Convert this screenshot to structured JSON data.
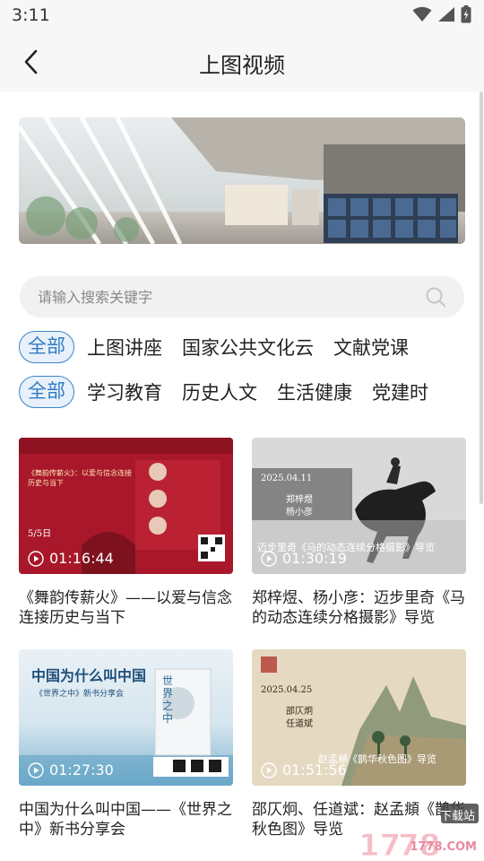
{
  "status_bar": {
    "time": "3:11"
  },
  "nav": {
    "title": "上图视频"
  },
  "search": {
    "placeholder": "请输入搜索关键字"
  },
  "categories_row1": {
    "selected": "全部",
    "items": [
      "上图讲座",
      "国家公共文化云",
      "文献党课"
    ]
  },
  "categories_row2": {
    "selected": "全部",
    "items": [
      "学习教育",
      "历史人文",
      "生活健康",
      "党建时"
    ]
  },
  "videos": [
    {
      "title": "《舞韵传薪火》——以爱与信念连接历史与当下",
      "duration": "01:16:44",
      "thumb": {
        "heading": "《舞韵传薪火》：以爱与信念连接历史与当下",
        "date": "5/5日",
        "color": "#b01c2e"
      }
    },
    {
      "title": "郑梓煜、杨小彦：迈步里奇《马的动态连续分格摄影》导览",
      "duration": "01:30:19",
      "thumb": {
        "date": "2025.04.11",
        "speaker1": "郑梓煜",
        "speaker2": "杨小彦",
        "caption": "迈步里奇《马的动态连续分格摄影》导览",
        "color": "#dcdcdc"
      }
    },
    {
      "title": "中国为什么叫中国——《世界之中》新书分享会",
      "duration": "01:27:30",
      "thumb": {
        "heading": "中国为什么叫中国",
        "subheading": "《世界之中》新书分享会",
        "book": "世界之中",
        "color": "#e4edf4"
      }
    },
    {
      "title": "邵仄炯、任道斌：赵孟頫《鹊华秋色图》导览",
      "duration": "01:51:56",
      "thumb": {
        "date": "2025.04.25",
        "speaker1": "邵仄炯",
        "speaker2": "任道斌",
        "caption": "赵孟頫《鹊华秋色图》导览",
        "color": "#e8dcc8"
      }
    }
  ],
  "watermark": {
    "text": "下载站",
    "domain": "1778.COM"
  },
  "colors": {
    "accent": "#2f79c4",
    "pill_bg": "#e8f1fb",
    "search_bg": "#f1f1f1",
    "header_bg": "#f7f7f7"
  }
}
